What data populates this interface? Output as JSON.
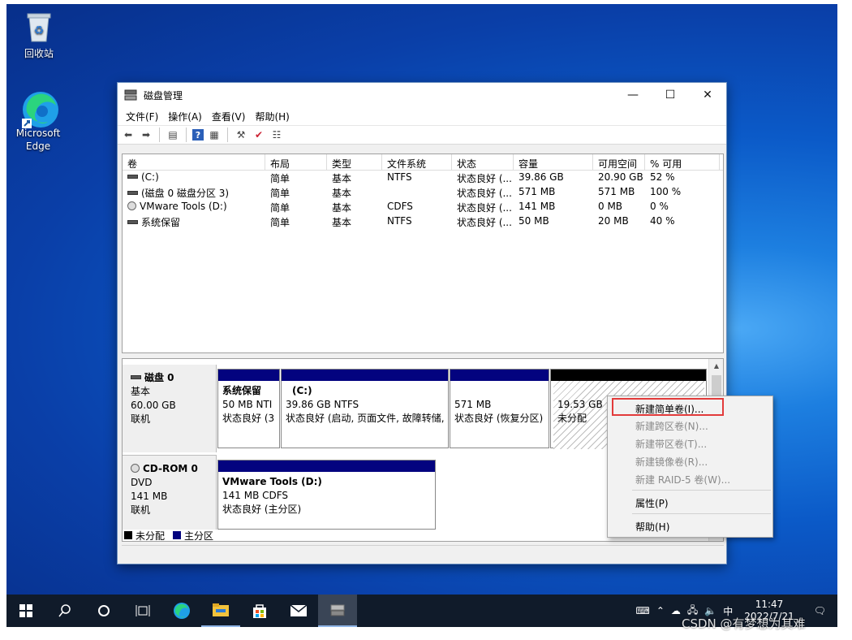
{
  "desktop": {
    "icons": [
      {
        "label": "回收站"
      },
      {
        "label": "Microsoft Edge"
      }
    ]
  },
  "window": {
    "title": "磁盘管理",
    "controls": {
      "minimize": "—",
      "maximize": "☐",
      "close": "✕"
    },
    "menu": [
      "文件(F)",
      "操作(A)",
      "查看(V)",
      "帮助(H)"
    ]
  },
  "volumes": {
    "headers": [
      "卷",
      "布局",
      "类型",
      "文件系统",
      "状态",
      "容量",
      "可用空间",
      "% 可用"
    ],
    "rows": [
      {
        "name": "(C:)",
        "layout": "简单",
        "type": "基本",
        "fs": "NTFS",
        "status": "状态良好 (...",
        "capacity": "39.86 GB",
        "free": "20.90 GB",
        "pct": "52 %"
      },
      {
        "name": "(磁盘 0 磁盘分区 3)",
        "layout": "简单",
        "type": "基本",
        "fs": "",
        "status": "状态良好 (...",
        "capacity": "571 MB",
        "free": "571 MB",
        "pct": "100 %"
      },
      {
        "name": "VMware Tools (D:)",
        "layout": "简单",
        "type": "基本",
        "fs": "CDFS",
        "status": "状态良好 (...",
        "capacity": "141 MB",
        "free": "0 MB",
        "pct": "0 %"
      },
      {
        "name": "系统保留",
        "layout": "简单",
        "type": "基本",
        "fs": "NTFS",
        "status": "状态良好 (...",
        "capacity": "50 MB",
        "free": "20 MB",
        "pct": "40 %"
      }
    ]
  },
  "disks": [
    {
      "name": "磁盘 0",
      "type": "基本",
      "size": "60.00 GB",
      "state": "联机",
      "partitions": [
        {
          "name": "系统保留",
          "line1": "50 MB NTI",
          "line2": "状态良好 (3"
        },
        {
          "name": "(C:)",
          "line1": "39.86 GB NTFS",
          "line2": "状态良好 (启动, 页面文件, 故障转储,"
        },
        {
          "name": "",
          "line1": "571 MB",
          "line2": "状态良好 (恢复分区)"
        },
        {
          "name": "",
          "line1": "19.53 GB",
          "line2": "未分配"
        }
      ]
    },
    {
      "name": "CD-ROM 0",
      "type": "DVD",
      "size": "141 MB",
      "state": "联机",
      "partitions": [
        {
          "name": "VMware Tools  (D:)",
          "line1": "141 MB CDFS",
          "line2": "状态良好 (主分区)"
        }
      ]
    }
  ],
  "legend": {
    "unallocated": "未分配",
    "primary": "主分区"
  },
  "context_menu": {
    "items": [
      {
        "label": "新建简单卷(I)...",
        "enabled": true
      },
      {
        "label": "新建跨区卷(N)...",
        "enabled": false
      },
      {
        "label": "新建带区卷(T)...",
        "enabled": false
      },
      {
        "label": "新建镜像卷(R)...",
        "enabled": false
      },
      {
        "label": "新建 RAID-5 卷(W)...",
        "enabled": false
      },
      {
        "label": "属性(P)",
        "enabled": true
      },
      {
        "label": "帮助(H)",
        "enabled": true
      }
    ]
  },
  "taskbar": {
    "ime": "中",
    "time": "11:47",
    "date": "2022/7/21"
  },
  "watermark": "CSDN @有梦想为其难",
  "colors": {
    "primary_partition": "#03037f",
    "unallocated": "#000000",
    "highlight_box": "#e23b3b"
  }
}
